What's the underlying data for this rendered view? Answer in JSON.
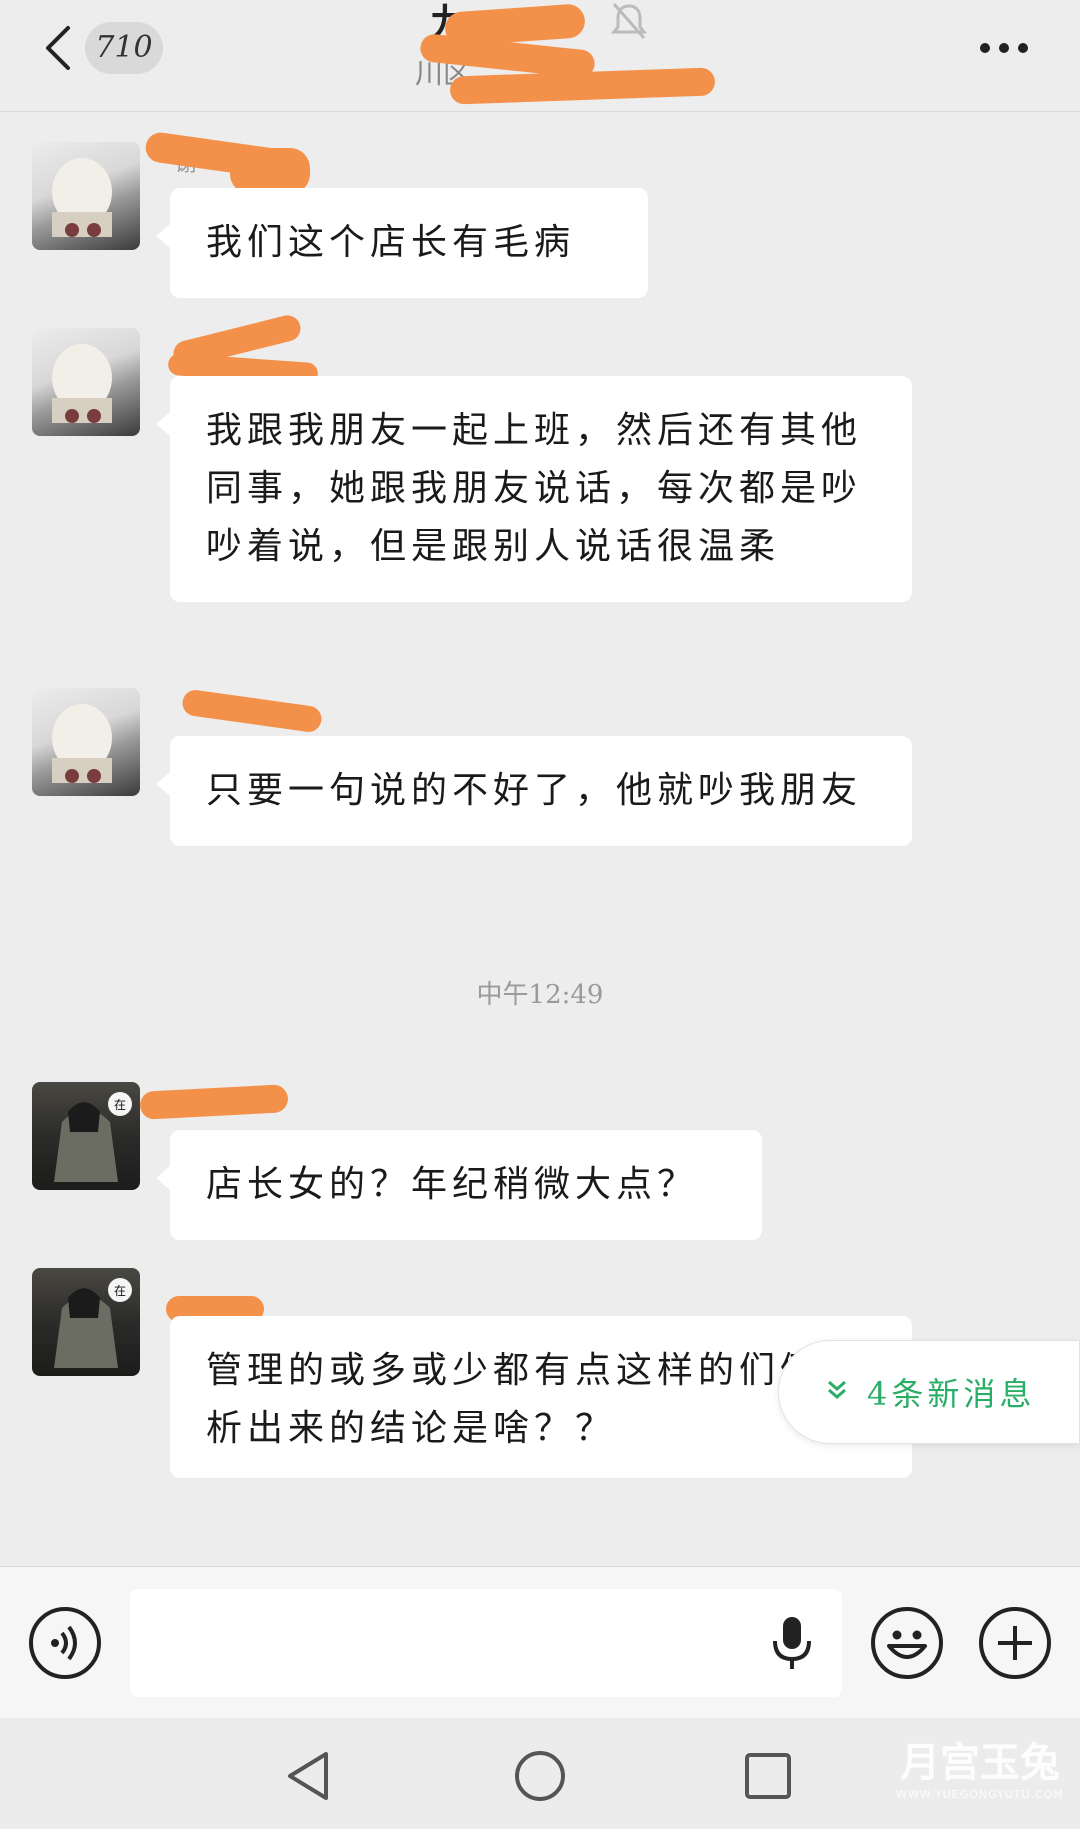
{
  "header": {
    "unread_count": "710",
    "title": "九",
    "subtitle": "川区"
  },
  "messages": [
    {
      "sender": "谢",
      "text": "我们这个店长有毛病"
    },
    {
      "sender": "",
      "text": "我跟我朋友一起上班，然后还有其他同事，她跟我朋友说话，每次都是吵吵着说，但是跟别人说话很温柔"
    },
    {
      "sender": "",
      "text": "只要一句说的不好了，他就吵我朋友"
    },
    {
      "sender": "",
      "text": "店长女的？年纪稍微大点？"
    },
    {
      "sender": "",
      "text": "管理的或多或少都有点这样的们俩分析出来的结论是啥？？"
    }
  ],
  "timestamp": "中午12:49",
  "new_messages_label": "4条新消息",
  "input": {
    "placeholder": ""
  },
  "watermark": {
    "main": "月宫玉兔",
    "url": "WWW.YUEGONGYUTU.COM"
  }
}
